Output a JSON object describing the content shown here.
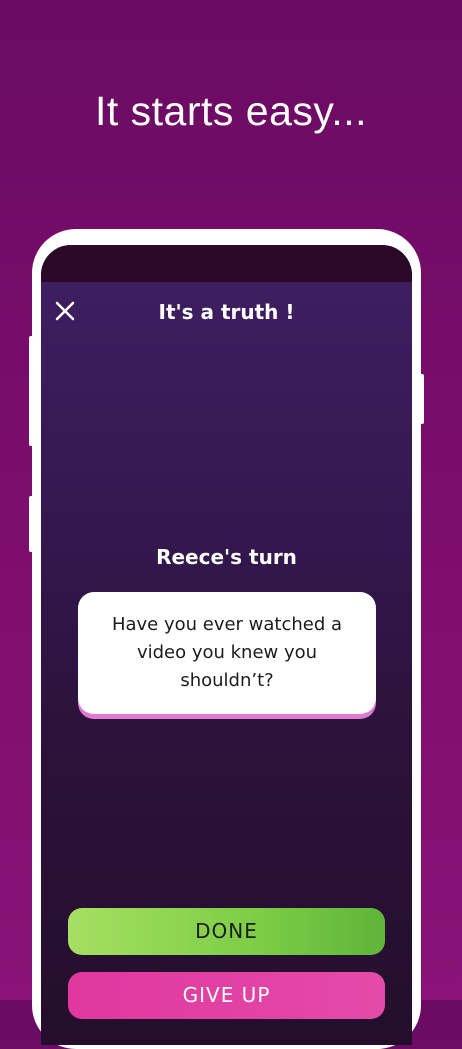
{
  "headline": "It starts easy...",
  "screen": {
    "close_icon": "close-icon",
    "title": "It's a truth !",
    "turn_label": "Reece's turn",
    "question": "Have you ever watched a video you knew you shouldn’t?",
    "done_label": "DONE",
    "give_up_label": "GIVE UP"
  },
  "colors": {
    "background": "#7a0d6c",
    "done_button": "#7ccd46",
    "give_up_button": "#e0389e",
    "card_shadow": "#e07ad0"
  }
}
